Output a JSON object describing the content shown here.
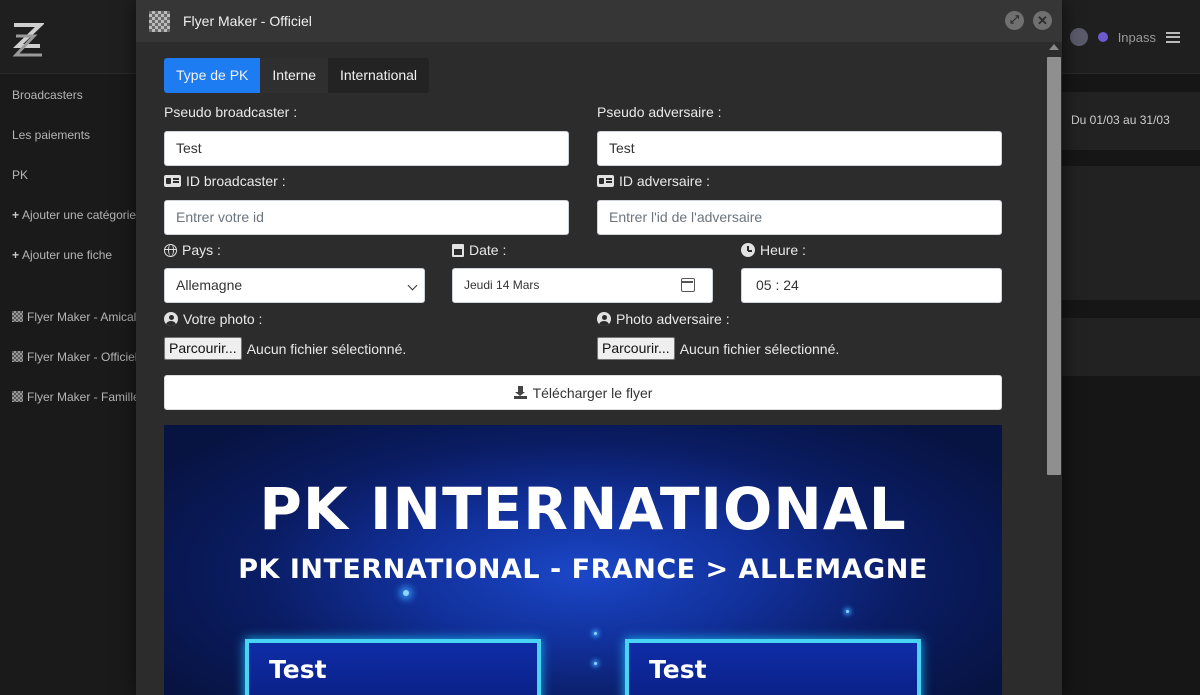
{
  "background": {
    "sidebar": [
      {
        "label": "Broadcasters",
        "kind": "plain"
      },
      {
        "label": "Les paiements",
        "kind": "plain"
      },
      {
        "label": "PK",
        "kind": "plain"
      },
      {
        "label": "Ajouter une catégorie",
        "kind": "plus"
      },
      {
        "label": "Ajouter une fiche",
        "kind": "plus"
      },
      {
        "label": "Flyer Maker - Amical",
        "kind": "flag"
      },
      {
        "label": "Flyer Maker - Officiel",
        "kind": "flag"
      },
      {
        "label": "Flyer Maker - Famille",
        "kind": "flag"
      }
    ],
    "user": "Inpass",
    "date_range": "Du 01/03 au 31/03"
  },
  "modal": {
    "title": "Flyer Maker - Officiel",
    "tabs": [
      {
        "label": "Type de PK",
        "active": true
      },
      {
        "label": "Interne",
        "active": false
      },
      {
        "label": "International",
        "active": false
      }
    ],
    "form": {
      "broadcaster_label": "Pseudo broadcaster :",
      "broadcaster_value": "Test",
      "adversary_label": "Pseudo adversaire :",
      "adversary_value": "Test",
      "id_broadcaster_label": "ID broadcaster :",
      "id_broadcaster_placeholder": "Entrer votre id",
      "id_adversary_label": "ID adversaire :",
      "id_adversary_placeholder": "Entrer l'id de l'adversaire",
      "country_label": "Pays :",
      "country_value": "Allemagne",
      "date_label": "Date :",
      "date_value": "Jeudi 14 Mars",
      "time_label": "Heure :",
      "time_value": "05 : 24",
      "photo_label": "Votre photo :",
      "photo_adversary_label": "Photo adversaire :",
      "browse_label": "Parcourir...",
      "no_file_text": "Aucun fichier sélectionné.",
      "download_label": "Télécharger le flyer"
    },
    "flyer": {
      "title": "PK INTERNATIONAL",
      "subtitle": "PK INTERNATIONAL - FRANCE > ALLEMAGNE",
      "left_name": "Test",
      "right_name": "Test"
    }
  },
  "colors": {
    "accent": "#1e7cf2",
    "modal_bg": "#2c2c2c",
    "flyer_blue": "#11309a",
    "flyer_cyan": "#49d3f5"
  }
}
